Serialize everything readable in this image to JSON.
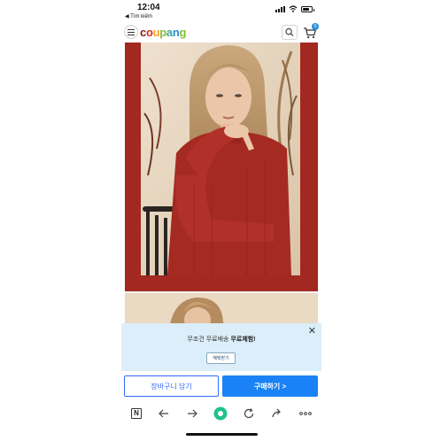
{
  "status_bar": {
    "time": "12:04",
    "back_label": "◀ Tìm kiếm",
    "battery_level": 0.75
  },
  "header": {
    "logo_letters": [
      {
        "char": "c",
        "color": "#7b1f14"
      },
      {
        "char": "o",
        "color": "#d0291f"
      },
      {
        "char": "u",
        "color": "#f2a521"
      },
      {
        "char": "p",
        "color": "#8bbb38"
      },
      {
        "char": "a",
        "color": "#34a7a0"
      },
      {
        "char": "n",
        "color": "#2c8bd6"
      },
      {
        "char": "g",
        "color": "#7fbf2f"
      }
    ],
    "cart_count": "0"
  },
  "product": {
    "frame_color": "#a3281f",
    "sweater_color": "#a52a22"
  },
  "promo": {
    "text_prefix": "무조건 무료배송 ",
    "text_bold": "무료체험!",
    "button_label": "혜택받기",
    "close_label": "✕"
  },
  "actions": {
    "add_to_cart_label": "장바구니 담기",
    "buy_now_label": "구매하기 >"
  },
  "browser": {
    "tab_label": "N"
  },
  "colors": {
    "primary_blue": "#346aff",
    "buy_blue": "#1a82f6",
    "promo_bg": "#dbeef9",
    "browser_accent": "#1fc28e"
  }
}
